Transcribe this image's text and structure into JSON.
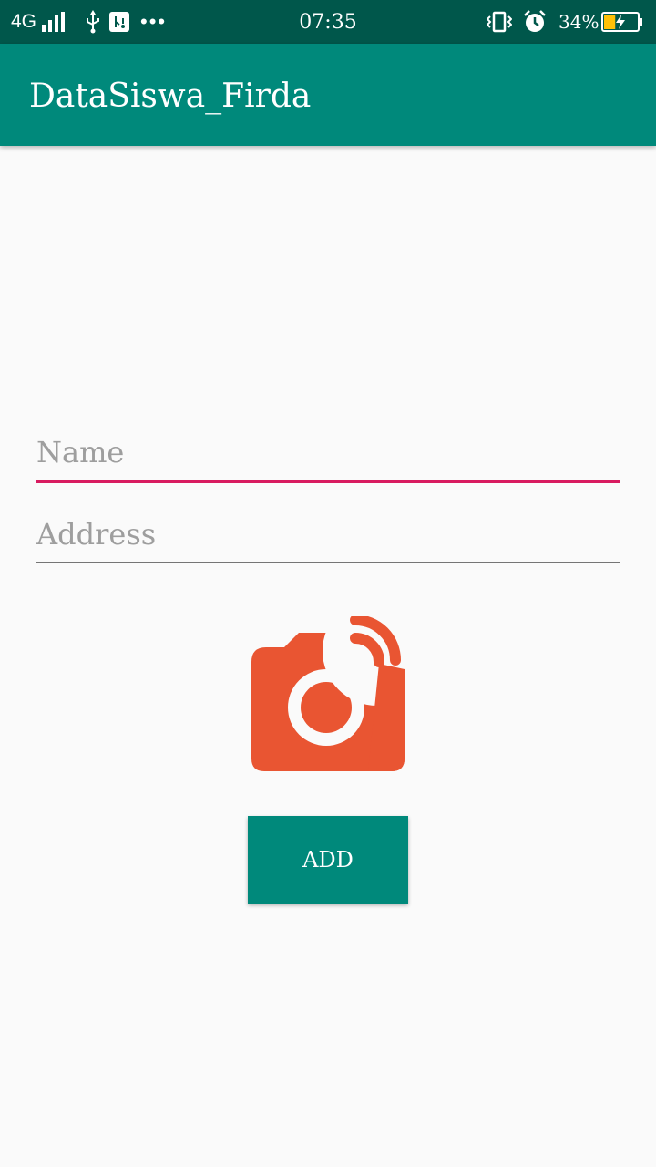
{
  "status_bar": {
    "network": "4G",
    "time": "07:35",
    "battery_percent": "34%",
    "battery_level": 0.34,
    "icons": [
      "signal-icon",
      "usb-icon",
      "usb-debug-icon",
      "more-icon",
      "vibrate-icon",
      "alarm-icon",
      "battery-icon"
    ]
  },
  "app_bar": {
    "title": "DataSiswa_Firda",
    "background": "#00897b"
  },
  "form": {
    "name": {
      "value": "",
      "placeholder": "Name",
      "focused": true
    },
    "address": {
      "value": "",
      "placeholder": "Address"
    },
    "camera_icon": "camera-icon",
    "add_label": "ADD"
  },
  "colors": {
    "status_bar": "#00574b",
    "primary": "#00897b",
    "accent": "#d81b60",
    "camera": "#e95532"
  }
}
